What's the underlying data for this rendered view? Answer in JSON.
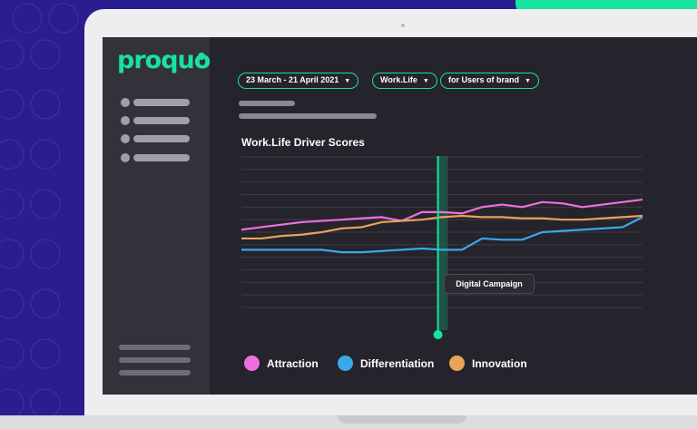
{
  "app": {
    "logo_text": "proquo"
  },
  "filters": {
    "date_range": "23 March - 21 April 2021",
    "category": "Work.Life",
    "audience": "for Users of brand"
  },
  "chart": {
    "annotation_label": "Digital Campaign"
  },
  "colors": {
    "background": "#2a1d8f",
    "accent": "#17e39e",
    "screen": "#25232b",
    "sidebar": "#33313a",
    "attraction": "#ef6fe0",
    "differentiation": "#3aa8ea",
    "innovation": "#e6a457"
  },
  "chart_data": {
    "type": "line",
    "title": "Work.Life Driver Scores",
    "x": [
      0,
      1,
      2,
      3,
      4,
      5,
      6,
      7,
      8,
      9,
      10,
      11,
      12,
      13,
      14,
      15,
      16,
      17,
      18,
      19,
      20
    ],
    "ylim": [
      0,
      12
    ],
    "grid": true,
    "legend_position": "bottom",
    "annotation": {
      "label": "Digital Campaign",
      "x": 9.8
    },
    "series": [
      {
        "name": "Attraction",
        "color": "#ef6fe0",
        "values": [
          6.2,
          6.4,
          6.6,
          6.8,
          6.9,
          7.0,
          7.1,
          7.2,
          6.9,
          7.6,
          7.6,
          7.5,
          8.0,
          8.2,
          8.0,
          8.4,
          8.3,
          8.0,
          8.2,
          8.4,
          8.6
        ]
      },
      {
        "name": "Differentiation",
        "color": "#3aa8ea",
        "values": [
          4.6,
          4.6,
          4.6,
          4.6,
          4.6,
          4.4,
          4.4,
          4.5,
          4.6,
          4.7,
          4.6,
          4.6,
          5.5,
          5.4,
          5.4,
          6.0,
          6.1,
          6.2,
          6.3,
          6.4,
          7.2
        ]
      },
      {
        "name": "Innovation",
        "color": "#e6a457",
        "values": [
          5.5,
          5.5,
          5.7,
          5.8,
          6.0,
          6.3,
          6.4,
          6.8,
          6.9,
          7.0,
          7.2,
          7.3,
          7.2,
          7.2,
          7.1,
          7.1,
          7.0,
          7.0,
          7.1,
          7.2,
          7.3
        ]
      }
    ]
  }
}
